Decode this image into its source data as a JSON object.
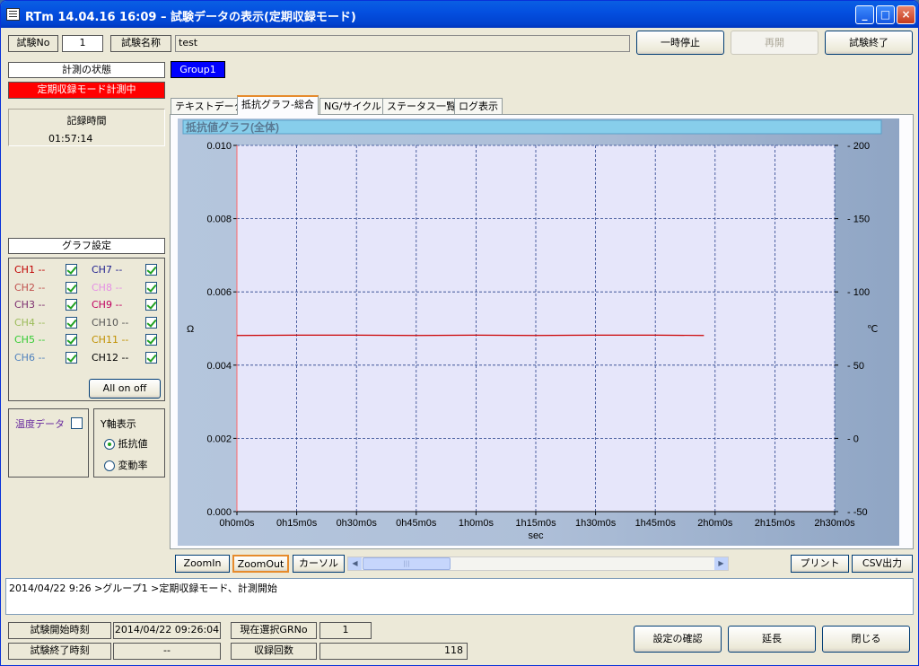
{
  "window": {
    "title": "RTm 14.04.16 16:09 – 試験データの表示(定期収録モード)",
    "minimize": "_",
    "maximize": "□",
    "close": "×"
  },
  "header": {
    "test_no_label": "試験No",
    "test_no": "1",
    "test_name_label": "試験名称",
    "test_name": "test",
    "pause_button": "一時停止",
    "resume_button": "再開",
    "end_button": "試験終了"
  },
  "status": {
    "title": "計測の状態",
    "value": "定期収録モード計測中"
  },
  "record_time": {
    "title": "記録時間",
    "value": "01:57:14"
  },
  "group_button": "Group1",
  "tabs": [
    "テキストデータ",
    "抵抗グラフ-総合",
    "NG/サイクル",
    "ステータス一覧",
    "ログ表示"
  ],
  "graph_settings": {
    "title": "グラフ設定",
    "channels": [
      {
        "label": "CH1 --",
        "color": "#c00000",
        "checked": true
      },
      {
        "label": "CH2 --",
        "color": "#c0504d",
        "checked": true
      },
      {
        "label": "CH3 --",
        "color": "#7b2c6e",
        "checked": true
      },
      {
        "label": "CH4 --",
        "color": "#9bbb59",
        "checked": true
      },
      {
        "label": "CH5 --",
        "color": "#33cc33",
        "checked": true
      },
      {
        "label": "CH6 --",
        "color": "#4f81bd",
        "checked": true
      },
      {
        "label": "CH7 --",
        "color": "#1f1f8f",
        "checked": true
      },
      {
        "label": "CH8 --",
        "color": "#e58fe5",
        "checked": true
      },
      {
        "label": "CH9 --",
        "color": "#c00060",
        "checked": true
      },
      {
        "label": "CH10 --",
        "color": "#555555",
        "checked": true
      },
      {
        "label": "CH11 --",
        "color": "#c09000",
        "checked": true
      },
      {
        "label": "CH12 --",
        "color": "#000000",
        "checked": true
      }
    ],
    "all_on_off": "All on off"
  },
  "temperature": {
    "label": "温度データ",
    "checked": false
  },
  "y_axis": {
    "title": "Y軸表示",
    "options": [
      {
        "label": "抵抗値",
        "selected": true
      },
      {
        "label": "変動率",
        "selected": false
      }
    ]
  },
  "chart_data": {
    "type": "line",
    "title": "抵抗値グラフ(全体)",
    "xlabel": "sec",
    "ylabel": "Ω",
    "y2label": "℃",
    "x_ticks": [
      "0h0m0s",
      "0h15m0s",
      "0h30m0s",
      "0h45m0s",
      "1h0m0s",
      "1h15m0s",
      "1h30m0s",
      "1h45m0s",
      "2h0m0s",
      "2h15m0s",
      "2h30m0s"
    ],
    "y_ticks": [
      "0.000",
      "0.002",
      "0.004",
      "0.006",
      "0.008",
      "0.010"
    ],
    "y2_ticks": [
      "-50",
      "0",
      "50",
      "100",
      "150",
      "200"
    ],
    "ylim": [
      0,
      0.01
    ],
    "xlim_minutes": [
      0,
      150
    ],
    "grid": true,
    "series": [
      {
        "color": "#cc0000",
        "x_minutes": [
          0,
          15,
          30,
          45,
          60,
          75,
          90,
          105,
          117.2
        ],
        "values": [
          0.00481,
          0.00482,
          0.00482,
          0.00481,
          0.00482,
          0.00481,
          0.00482,
          0.00482,
          0.00481
        ]
      }
    ]
  },
  "chart_controls": {
    "zoom_in": "ZoomIn",
    "zoom_out": "ZoomOut",
    "cursor": "カーソル",
    "print": "プリント",
    "csv": "CSV出力",
    "scroll_left": "◀",
    "scroll_right": "▶",
    "scroll_grip": "|||"
  },
  "log": {
    "text": "2014/04/22 9:26 >グループ1 >定期収録モード、計測開始"
  },
  "footer": {
    "start_label": "試験開始時刻",
    "start_value": "2014/04/22 09:26:04",
    "grno_label": "現在選択GRNo",
    "grno_value": "1",
    "end_label": "試験終了時刻",
    "end_value": "--",
    "count_label": "収録回数",
    "count_value": "118",
    "confirm_button": "設定の確認",
    "extend_button": "延長",
    "close_button": "閉じる"
  }
}
